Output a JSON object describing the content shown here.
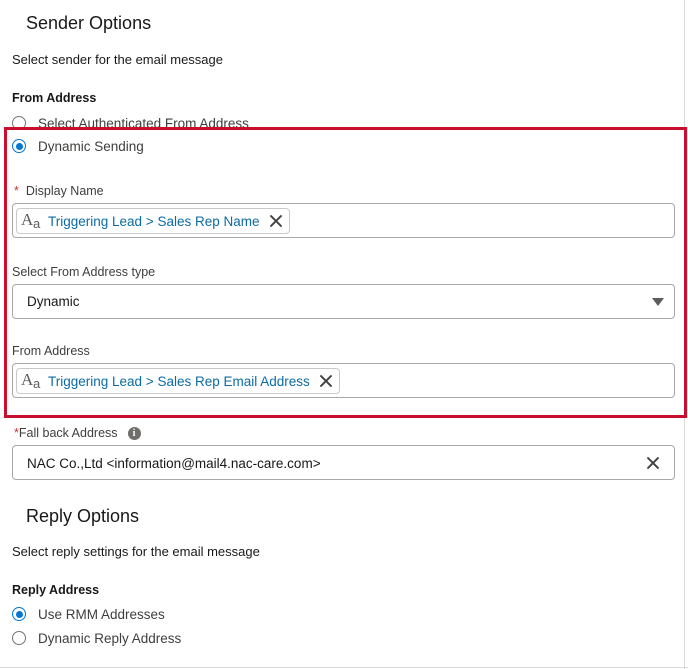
{
  "sender": {
    "title": "Sender Options",
    "description": "Select sender for the email message",
    "from_address_heading": "From Address",
    "options": [
      {
        "label": "Select Authenticated From Address",
        "checked": false
      },
      {
        "label": "Dynamic Sending",
        "checked": true
      }
    ],
    "display_name": {
      "required_mark": "*",
      "label": "Display Name",
      "pill": "Triggering Lead > Sales Rep Name"
    },
    "address_type": {
      "label": "Select From Address type",
      "value": "Dynamic"
    },
    "from_address": {
      "label": "From Address",
      "pill": "Triggering Lead > Sales Rep Email Address"
    },
    "fallback": {
      "required_mark": "*",
      "label": "Fall back Address",
      "info_glyph": "i",
      "value": "NAC Co.,Ltd <information@mail4.nac-care.com>"
    }
  },
  "reply": {
    "title": "Reply Options",
    "description": "Select reply settings for the email message",
    "heading": "Reply Address",
    "options": [
      {
        "label": "Use RMM Addresses",
        "checked": true
      },
      {
        "label": "Dynamic Reply Address",
        "checked": false
      }
    ]
  },
  "colors": {
    "accent": "#0176d3",
    "highlight": "#c8102e",
    "pill_text": "#0b6ba5",
    "required": "#c23934"
  }
}
